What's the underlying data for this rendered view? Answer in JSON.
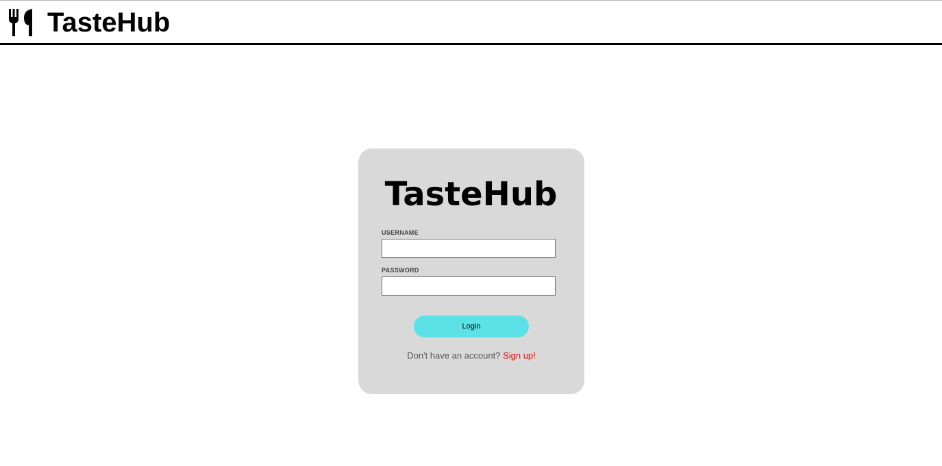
{
  "header": {
    "logo_icon": "fork-knife-icon",
    "title": "TasteHub"
  },
  "login_card": {
    "title": "TasteHub",
    "username_label": "USERNAME",
    "username_value": "",
    "password_label": "PASSWORD",
    "password_value": "",
    "login_label": "Login",
    "signup_prompt": "Don't have an account?",
    "signup_link": "Sign up!"
  },
  "colors": {
    "card_background": "#d9d9d9",
    "login_button": "#5ce1e6",
    "signup_link": "#ff0000",
    "header_border": "#000000"
  }
}
